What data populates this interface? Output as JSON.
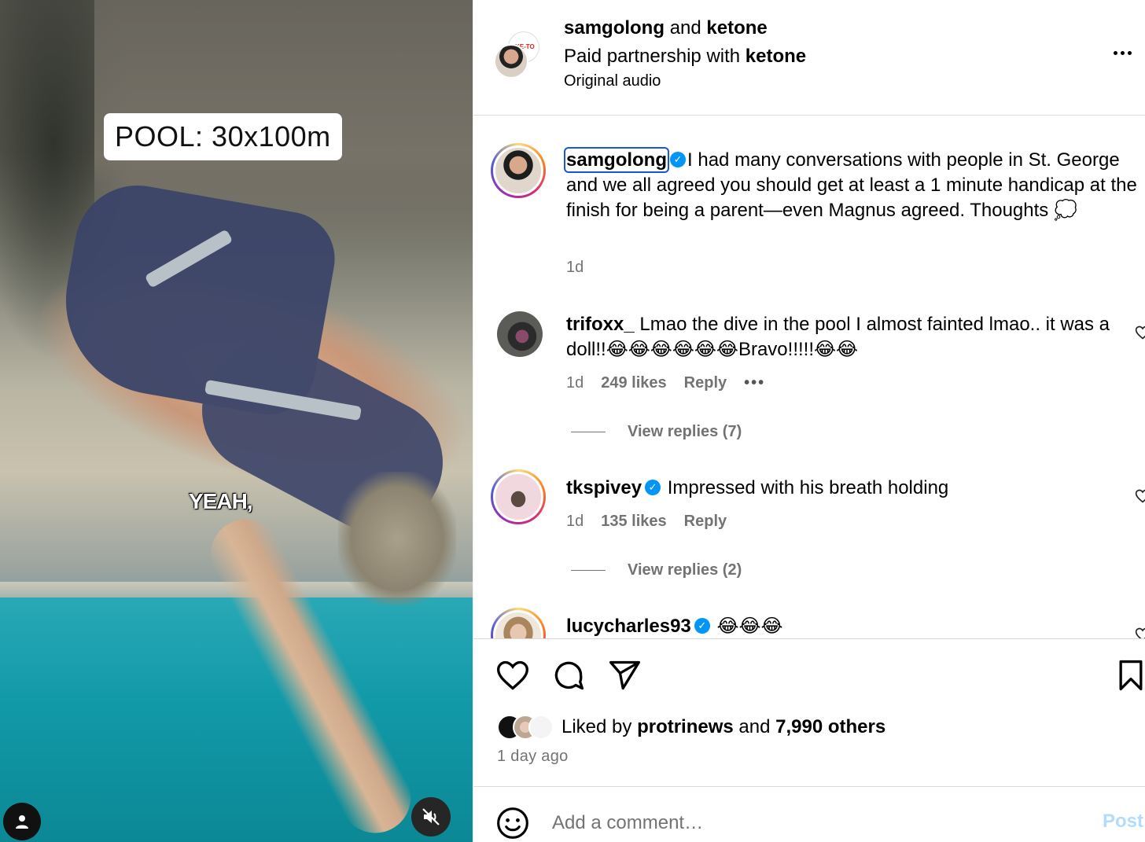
{
  "video": {
    "overlay_label": "POOL: 30x100m",
    "caption": "YEAH,"
  },
  "header": {
    "author": "samgolong",
    "and_word": "and",
    "collaborator": "ketone",
    "partnership_prefix": "Paid partnership with",
    "partner": "ketone",
    "audio": "Original audio",
    "collab_logo_text": "KE-TO"
  },
  "caption": {
    "username": "samgolong",
    "text": "I had many conversations with people in St. George and we all agreed you should get at least a 1 minute handicap at the finish for being a parent—even Magnus agreed. Thoughts 💭",
    "time": "1d"
  },
  "comments": [
    {
      "username": "trifoxx_",
      "verified": false,
      "text": "Lmao the dive in the pool I almost fainted lmao.. it was a doll!!😂😂😂😂😂😂Bravo!!!!!😂😂",
      "time": "1d",
      "likes": "249 likes",
      "reply": "Reply",
      "more": "•••",
      "view_replies": "View replies (7)"
    },
    {
      "username": "tkspivey",
      "verified": true,
      "text": "Impressed with his breath holding",
      "time": "1d",
      "likes": "135 likes",
      "reply": "Reply",
      "view_replies": "View replies (2)"
    },
    {
      "username": "lucycharles93",
      "verified": true,
      "text": "😂😂😂"
    }
  ],
  "likes": {
    "prefix": "Liked by",
    "first_user": "protrinews",
    "joiner": "and",
    "others": "7,990 others",
    "time_ago": "1 day ago"
  },
  "comment_box": {
    "placeholder": "Add a comment…",
    "post_label": "Post"
  },
  "colors": {
    "verified": "#0095f6",
    "meta_gray": "#737373",
    "post_disabled": "#b3dbff"
  },
  "icons": [
    "user-tag-icon",
    "mute-icon",
    "more-options-icon",
    "verified-icon",
    "heart-icon",
    "comment-icon",
    "share-icon",
    "bookmark-icon",
    "emoji-icon"
  ]
}
